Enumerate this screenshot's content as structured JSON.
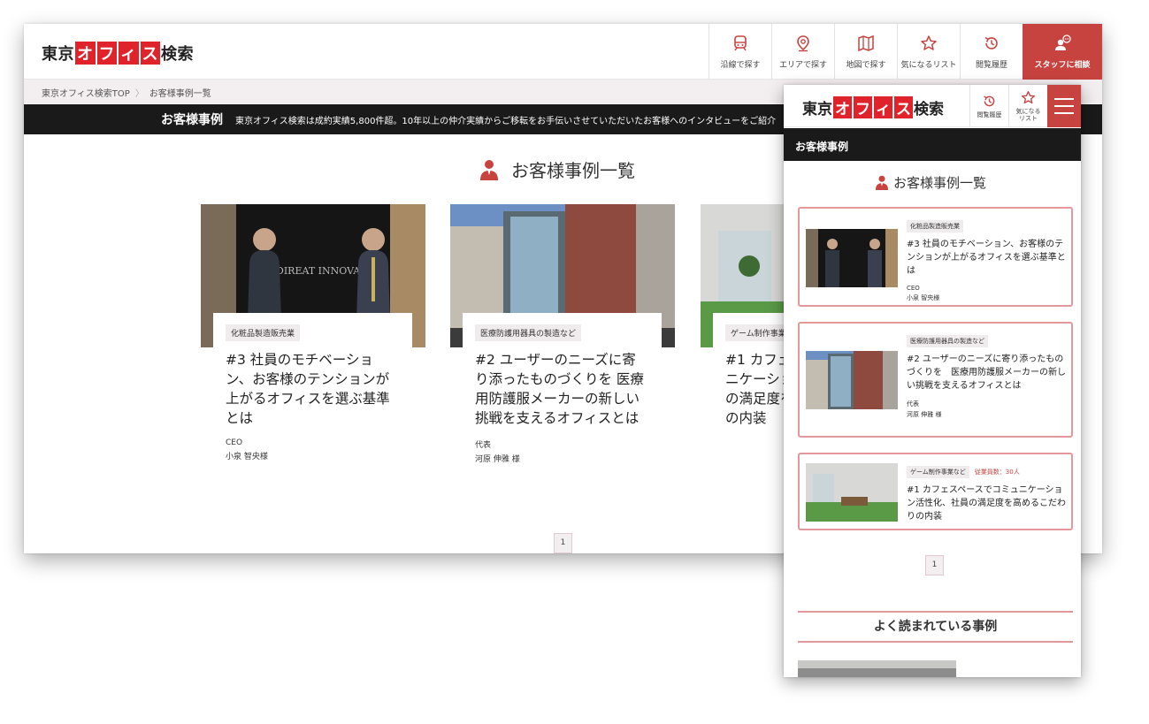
{
  "brand": {
    "logo_prefix": "東京",
    "logo_box": [
      "オ",
      "フ",
      "ィ",
      "ス"
    ],
    "logo_suffix": "検索"
  },
  "desktop": {
    "nav": [
      {
        "icon": "train-icon",
        "label": "沿線で探す"
      },
      {
        "icon": "map-pin-icon",
        "label": "エリアで探す"
      },
      {
        "icon": "map-icon",
        "label": "地図で探す"
      },
      {
        "icon": "star-icon",
        "label": "気になるリスト"
      },
      {
        "icon": "history-icon",
        "label": "閲覧履歴"
      },
      {
        "icon": "staff-chat-icon",
        "label": "スタッフに相談"
      }
    ],
    "breadcrumb": {
      "home": "東京オフィス検索TOP",
      "sep": "〉",
      "current": "お客様事例一覧"
    },
    "band": {
      "title": "お客様事例",
      "description": "東京オフィス検索は成約実績5,800件超。10年以上の仲介実績からご移転をお手伝いさせていただいたお客様へのインタビューをご紹介"
    },
    "heading": "お客様事例一覧",
    "cards": [
      {
        "tag": "化粧品製造販売業",
        "title": "#3 社員のモチベーション、お客様のテンションが上がるオフィスを選ぶ基準とは",
        "role": "CEO",
        "person": "小泉 智央様",
        "photo_text": "DIREAT INNOVATION"
      },
      {
        "tag": "医療防護用器具の製造など",
        "title": "#2 ユーザーのニーズに寄り添ったものづくりを 医療用防護服メーカーの新しい挑戦を支えるオフィスとは",
        "role": "代表",
        "person": "河原 伸雅 様"
      },
      {
        "tag": "ゲーム制作事業",
        "title": "#1 カフェスペースでコミュニケーション活性化、社員の満足度を高めるこだわりの内装",
        "role": "",
        "person": ""
      }
    ],
    "pagination": [
      "1"
    ]
  },
  "mobile": {
    "nav": [
      {
        "icon": "history-icon",
        "label": "閲覧履歴"
      },
      {
        "icon": "star-icon",
        "label": "気になる\nリスト"
      },
      {
        "icon": "hamburger-menu-icon",
        "label": ""
      }
    ],
    "band_title": "お客様事例",
    "heading": "お客様事例一覧",
    "cards": [
      {
        "tag": "化粧品製造販売業",
        "extra": "",
        "title": "#3 社員のモチベーション、お客様のテンションが上がるオフィスを選ぶ基準とは",
        "role": "CEO",
        "person": "小泉 智央様"
      },
      {
        "tag": "医療防護用器具の製造など",
        "extra": "",
        "title": "#2 ユーザーのニーズに寄り添ったものづくりを　医療用防護服メーカーの新しい挑戦を支えるオフィスとは",
        "role": "代表",
        "person": "河原 伸雅 様"
      },
      {
        "tag": "ゲーム制作事業など",
        "extra": "従業員数：30人",
        "title": "#1 カフェスペースでコミュニケーション活性化、社員の満足度を高めるこだわりの内装",
        "role": "",
        "person": ""
      }
    ],
    "pagination": [
      "1"
    ],
    "popular_heading": "よく読まれている事例"
  },
  "colors": {
    "accent": "#c7433f",
    "logo_red": "#e0232b",
    "band": "#1a1a1a",
    "crumb_bg": "#f3eef0",
    "card_border": "#e3999b"
  }
}
